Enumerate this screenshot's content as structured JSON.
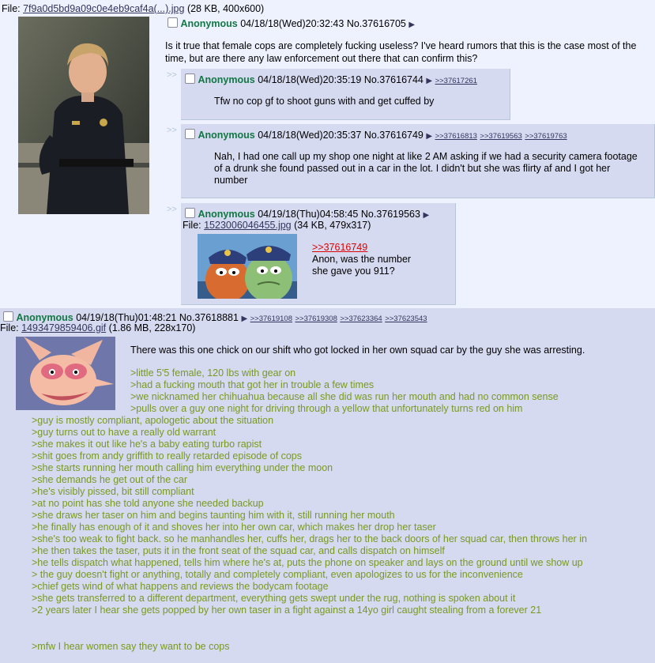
{
  "op": {
    "file_label": "File:",
    "file_name": "7f9a0d5bd9a09c0e4eb9caf4a(...).jpg",
    "file_info": "(28 KB, 400x600)",
    "name": "Anonymous",
    "datetime": "04/18/18(Wed)20:32:43",
    "post_no": "No.37616705",
    "text": "Is it true that female cops are completely fucking useless? I've heard rumors that this is the case most of the time, but are there any law enforcement out there that can confirm this?"
  },
  "replies": [
    {
      "name": "Anonymous",
      "datetime": "04/18/18(Wed)20:35:19",
      "post_no": "No.37616744",
      "backlinks": [
        ">>37617261"
      ],
      "text": "Tfw no cop gf to shoot guns with and get cuffed by"
    },
    {
      "name": "Anonymous",
      "datetime": "04/18/18(Wed)20:35:37",
      "post_no": "No.37616749",
      "backlinks": [
        ">>37616813",
        ">>37619563",
        ">>37619763"
      ],
      "text": "Nah, I had one call up my shop one night at like 2 AM asking if we had a security camera footage of a drunk she found passed out in a car in the lot. I didn't but she was flirty af and I got her number"
    },
    {
      "name": "Anonymous",
      "datetime": "04/19/18(Thu)04:58:45",
      "post_no": "No.37619563",
      "file_label": "File:",
      "file_name": "1523006046455.jpg",
      "file_info": "(34 KB, 479x317)",
      "quotelink": ">>37616749",
      "text_lines": [
        "Anon, was the number",
        "she gave you 911?"
      ]
    }
  ],
  "big_post": {
    "name": "Anonymous",
    "datetime": "04/19/18(Thu)01:48:21",
    "post_no": "No.37618881",
    "backlinks": [
      ">>37619108",
      ">>37619308",
      ">>37623364",
      ">>37623543"
    ],
    "file_label": "File:",
    "file_name": "1493479859406.gif",
    "file_info": "(1.86 MB, 228x170)",
    "intro": "There was this one chick on our shift who got locked in her own squad car by the guy she was arresting.",
    "greentext_right": [
      ">little 5'5 female, 120 lbs with gear on",
      ">had a fucking mouth that got her in trouble a few times",
      ">we nicknamed her chihuahua because all she did was run her mouth and had no common sense",
      ">pulls over a guy one night for driving through a yellow that unfortunately turns red on him"
    ],
    "greentext_full": [
      ">guy is mostly compliant, apologetic about the situation",
      ">guy turns out to have a really old warrant",
      ">she makes it out like he's a baby eating turbo rapist",
      ">shit goes from andy griffith to really retarded episode of cops",
      ">she starts running her mouth calling him everything under the moon",
      ">she demands he get out of the car",
      ">he's visibly pissed, bit still compliant",
      ">at no point has she told anyone she needed backup",
      ">she draws her taser on him and begins taunting him with it, still running her mouth",
      ">he finally has enough of it and shoves her into her own car, which makes her drop her taser",
      ">she's too weak to fight back. so he manhandles her, cuffs her, drags her to the back doors of her squad car, then throws her in",
      ">he then takes the taser, puts it in the front seat of the squad car, and calls dispatch on himself",
      ">he tells dispatch what happened, tells him where he's at, puts the phone on speaker and lays on the ground until we show up",
      "> the guy doesn't fight or anything, totally and completely compliant, even apologizes to us for the inconvenience",
      ">chief gets wind of what happens and reviews the bodycam footage",
      ">she gets transferred to a different department, everything gets swept under the rug, nothing is spoken about it",
      ">2 years later I hear she gets popped by her own taser in a fight against a 14yo girl caught stealing from a forever 21"
    ],
    "closing": ">mfw I hear women say they want to be cops"
  },
  "ui": {
    "side_arrows": ">>",
    "menu_arrow": "▶"
  },
  "colors": {
    "background": "#eef2ff",
    "reply_bg": "#d6daf0",
    "name_green": "#117743",
    "greentext": "#789922",
    "quotelink_red": "#dd0000"
  }
}
